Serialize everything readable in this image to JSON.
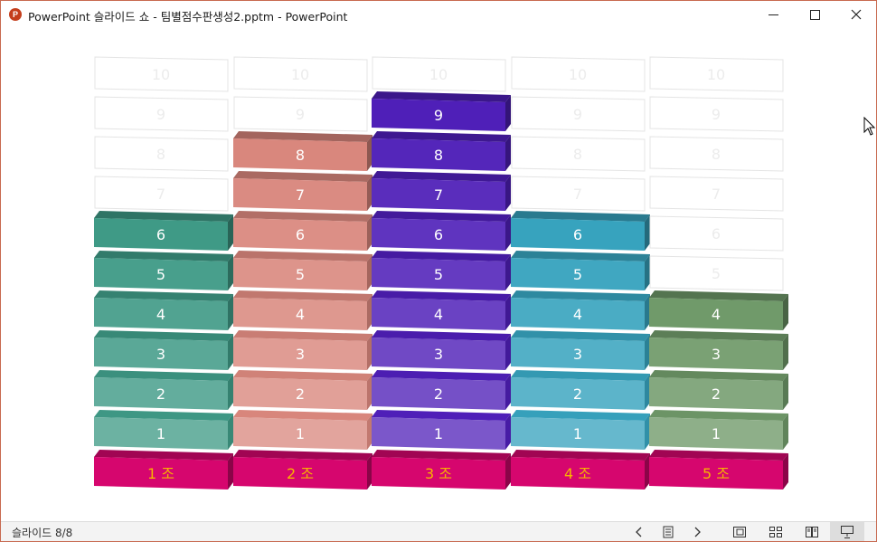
{
  "window": {
    "title": "PowerPoint 슬라이드 쇼  -  팀별점수판생성2.pptm - PowerPoint",
    "app_icon_letter": "P",
    "buttons": [
      "minimize-icon",
      "maximize-icon",
      "close-icon"
    ]
  },
  "status": {
    "slide_indicator": "슬라이드 8/8"
  },
  "status_icons": [
    "previous-slide-icon",
    "slide-menu-icon",
    "next-slide-icon",
    "normal-view-icon",
    "slide-sorter-icon",
    "reading-view-icon",
    "slideshow-icon"
  ],
  "board": {
    "max_score": 10,
    "teams": [
      {
        "label": "1 조",
        "score": 6,
        "color": "#3f9a86"
      },
      {
        "label": "2 조",
        "score": 8,
        "color": "#d9877d"
      },
      {
        "label": "3 조",
        "score": 9,
        "color": "#4f1fb8"
      },
      {
        "label": "4 조",
        "score": 6,
        "color": "#37a3be"
      },
      {
        "label": "5 조",
        "score": 4,
        "color": "#709a6a"
      }
    ],
    "base_color": "#d6066e",
    "label_color": "#f6b400"
  }
}
